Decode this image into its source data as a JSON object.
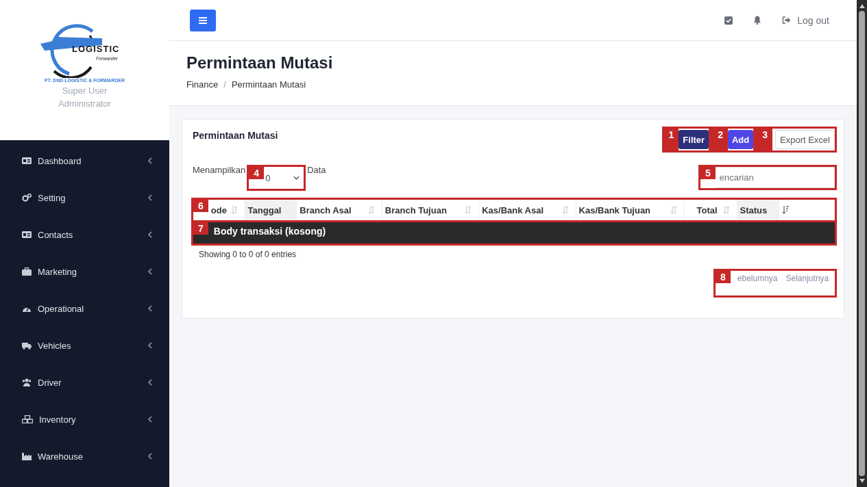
{
  "sidebar": {
    "logo": {
      "wordmark": "LOGISTIC",
      "tagline": "Forwarder",
      "company": "PT. DND LOGISTIC & FORWARDER"
    },
    "user": {
      "name": "Super User",
      "role": "Administrator"
    },
    "items": [
      {
        "label": "Dashboard",
        "kind": "card"
      },
      {
        "label": "Setting",
        "kind": "gears"
      },
      {
        "label": "Contacts",
        "kind": "card"
      },
      {
        "label": "Marketing",
        "kind": "briefcase"
      },
      {
        "label": "Operational",
        "kind": "gauge"
      },
      {
        "label": "Vehicles",
        "kind": "truck"
      },
      {
        "label": "Driver",
        "kind": "users"
      },
      {
        "label": "Inventory",
        "kind": "boxes"
      },
      {
        "label": "Warehouse",
        "kind": "industry"
      }
    ]
  },
  "topbar": {
    "logout": "Log out"
  },
  "header": {
    "title": "Permintaan Mutasi",
    "breadcrumb": [
      "Finance",
      "Permintaan Mutasi"
    ],
    "separator": "/"
  },
  "card": {
    "title": "Permintaan Mutasi",
    "buttons": [
      {
        "label": "Filter",
        "kind": "filter"
      },
      {
        "label": "Add",
        "kind": "add"
      },
      {
        "label": "Export Excel",
        "kind": "export"
      }
    ],
    "length": {
      "prefix": "Menampilkan",
      "value": "0",
      "suffix": "Data"
    },
    "search": {
      "placeholder": "encarian"
    },
    "table": {
      "columns": [
        {
          "label": "ode",
          "kind": "sortable",
          "sorted": false
        },
        {
          "label": "Tanggal",
          "kind": "plain",
          "sorted": true
        },
        {
          "label": "Branch Asal",
          "kind": "sortable",
          "sorted": false
        },
        {
          "label": "Branch Tujuan",
          "kind": "sortable",
          "sorted": false
        },
        {
          "label": "Kas/Bank Asal",
          "kind": "sortable",
          "sorted": false
        },
        {
          "label": "Kas/Bank Tujuan",
          "kind": "sortable",
          "sorted": false
        },
        {
          "label": "Total",
          "kind": "sortable",
          "sorted": false
        },
        {
          "label": "Status",
          "kind": "plain",
          "sorted": true
        },
        {
          "kind": "sort-active",
          "sorted": false
        }
      ]
    },
    "info": "Showing 0 to 0 of 0 entries",
    "pager": [
      "ebelumnya",
      "Selanjutnya"
    ]
  },
  "annotations": [
    {
      "number": "1",
      "kind": "outline"
    },
    {
      "number": "2",
      "kind": "outline"
    },
    {
      "number": "3",
      "kind": "outline"
    },
    {
      "number": "4",
      "kind": "outline"
    },
    {
      "number": "5",
      "kind": "outline"
    },
    {
      "number": "6",
      "kind": "outline"
    },
    {
      "number": "7",
      "label": "Body transaksi (kosong)",
      "kind": "filled"
    },
    {
      "number": "8",
      "kind": "outline"
    }
  ]
}
